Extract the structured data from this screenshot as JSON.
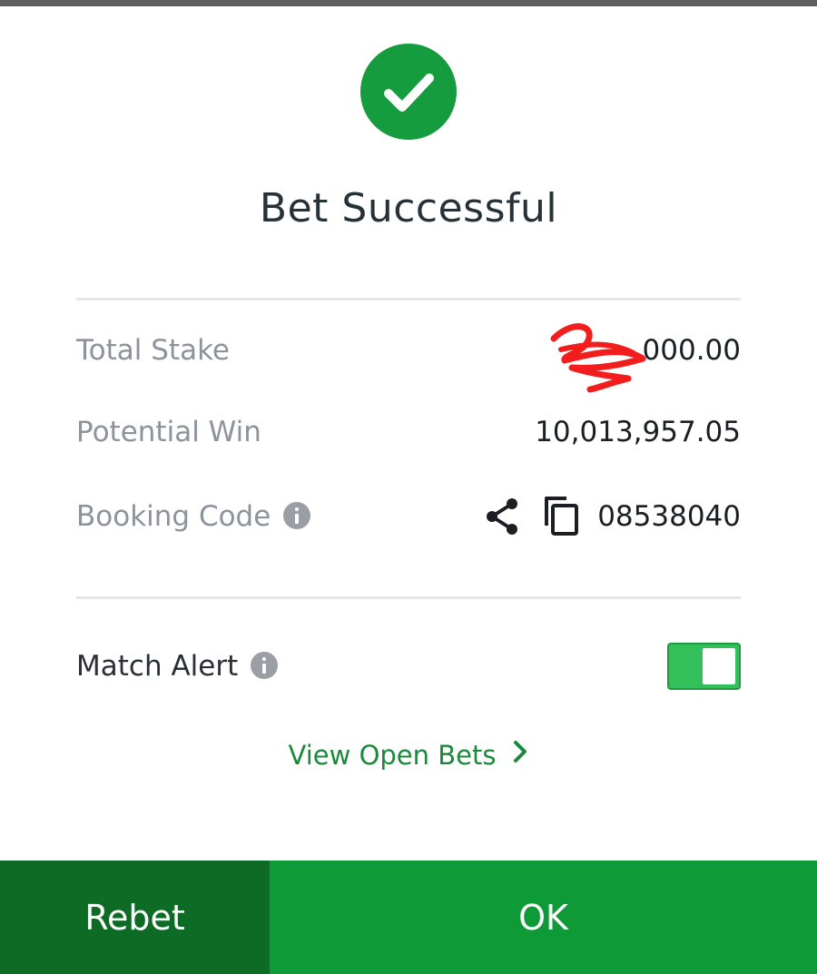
{
  "dialog": {
    "title": "Bet Successful",
    "icon": "check-circle-icon",
    "accent_color": "#149c3e"
  },
  "details": {
    "total_stake_label": "Total Stake",
    "total_stake_value": ".000.00",
    "potential_win_label": "Potential Win",
    "potential_win_value": "10,013,957.05",
    "booking_code_label": "Booking Code",
    "booking_code_value": "08538040"
  },
  "alerts": {
    "match_alert_label": "Match Alert",
    "match_alert_enabled": true
  },
  "links": {
    "view_open_bets": "View Open Bets"
  },
  "actions": {
    "rebet_label": "Rebet",
    "ok_label": "OK",
    "rebet_color": "#0d6b26",
    "ok_color": "#0f9a38"
  }
}
